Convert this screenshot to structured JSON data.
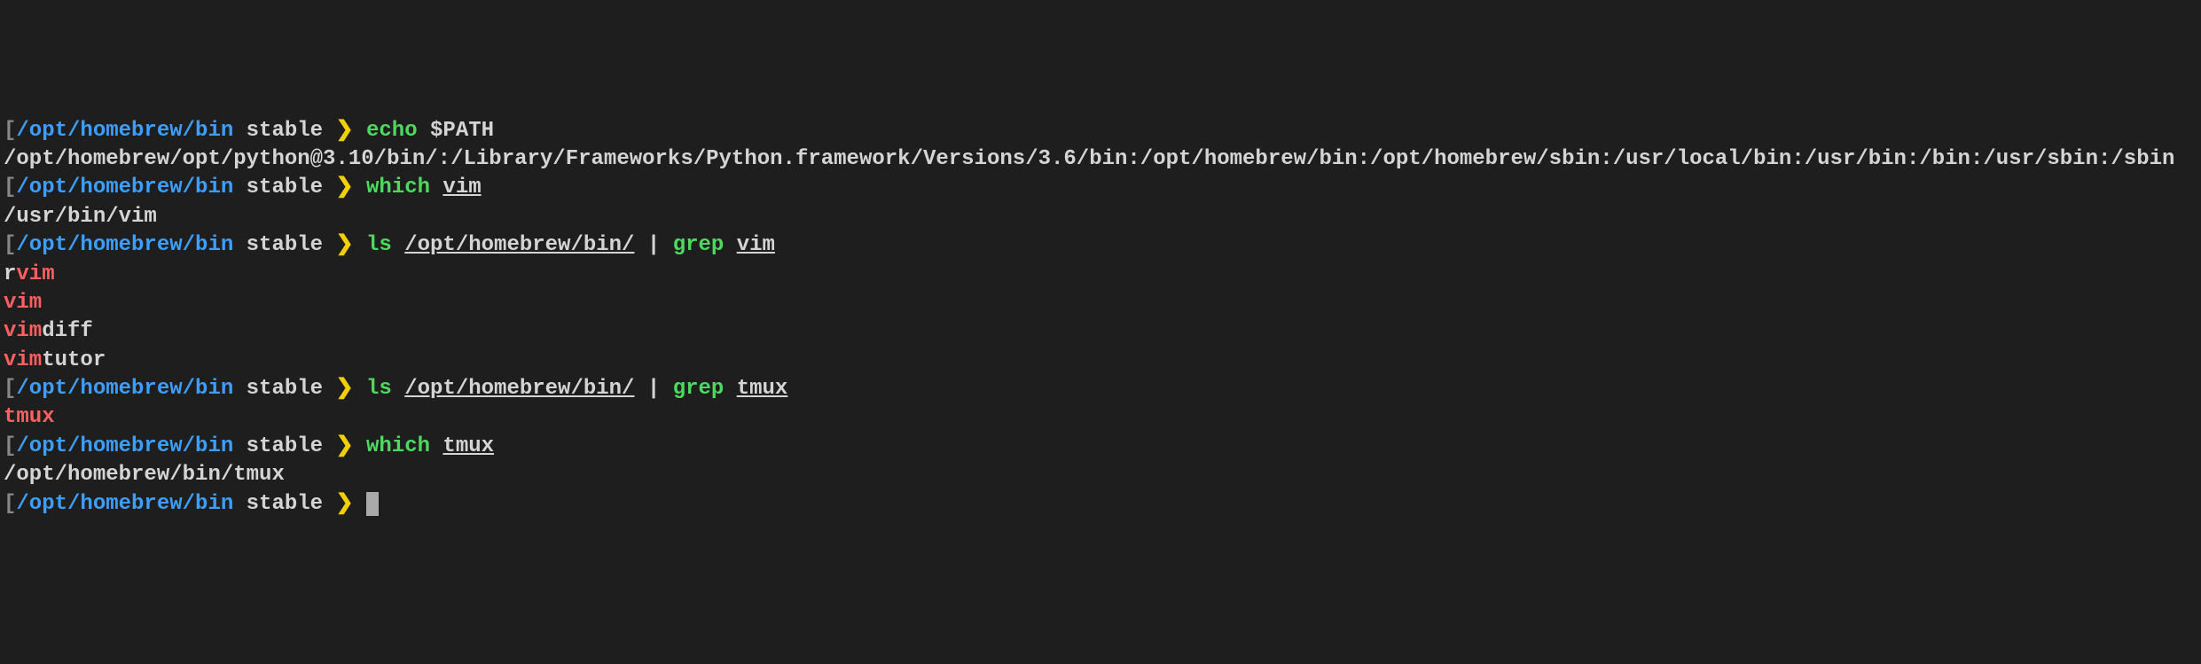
{
  "prompt": {
    "bracket_open": "[",
    "bracket_close": "]",
    "path": "/opt/homebrew/bin",
    "branch": "stable",
    "symbol": "❯"
  },
  "entries": [
    {
      "command": {
        "cmd": "echo",
        "args": [
          {
            "text": " $PATH",
            "underline": false
          }
        ]
      },
      "output_plain": "/opt/homebrew/opt/python@3.10/bin/:/Library/Frameworks/Python.framework/Versions/3.6/bin:/opt/homebrew/bin:/opt/homebrew/sbin:/usr/local/bin:/usr/bin:/bin:/usr/sbin:/sbin"
    },
    {
      "command": {
        "cmd": "which",
        "args": [
          {
            "text": " ",
            "underline": false
          },
          {
            "text": "vim",
            "underline": true
          }
        ]
      },
      "output_plain": "/usr/bin/vim"
    },
    {
      "command": {
        "cmd": "ls",
        "args": [
          {
            "text": " ",
            "underline": false
          },
          {
            "text": "/opt/homebrew/bin/",
            "underline": true
          },
          {
            "text": " | ",
            "pipe": true
          },
          {
            "text": "grep",
            "cmd": true
          },
          {
            "text": " ",
            "underline": false
          },
          {
            "text": "vim",
            "underline": true
          }
        ]
      },
      "output_grep": [
        [
          {
            "t": "r",
            "m": false
          },
          {
            "t": "vim",
            "m": true
          }
        ],
        [
          {
            "t": "vim",
            "m": true
          }
        ],
        [
          {
            "t": "vim",
            "m": true
          },
          {
            "t": "diff",
            "m": false
          }
        ],
        [
          {
            "t": "vim",
            "m": true
          },
          {
            "t": "tutor",
            "m": false
          }
        ]
      ]
    },
    {
      "command": {
        "cmd": "ls",
        "args": [
          {
            "text": " ",
            "underline": false
          },
          {
            "text": "/opt/homebrew/bin/",
            "underline": true
          },
          {
            "text": " | ",
            "pipe": true
          },
          {
            "text": "grep",
            "cmd": true
          },
          {
            "text": " ",
            "underline": false
          },
          {
            "text": "tmux",
            "underline": true
          }
        ]
      },
      "output_grep": [
        [
          {
            "t": "tmux",
            "m": true
          }
        ]
      ]
    },
    {
      "command": {
        "cmd": "which",
        "args": [
          {
            "text": " ",
            "underline": false
          },
          {
            "text": "tmux",
            "underline": true
          }
        ]
      },
      "output_plain": "/opt/homebrew/bin/tmux"
    }
  ]
}
